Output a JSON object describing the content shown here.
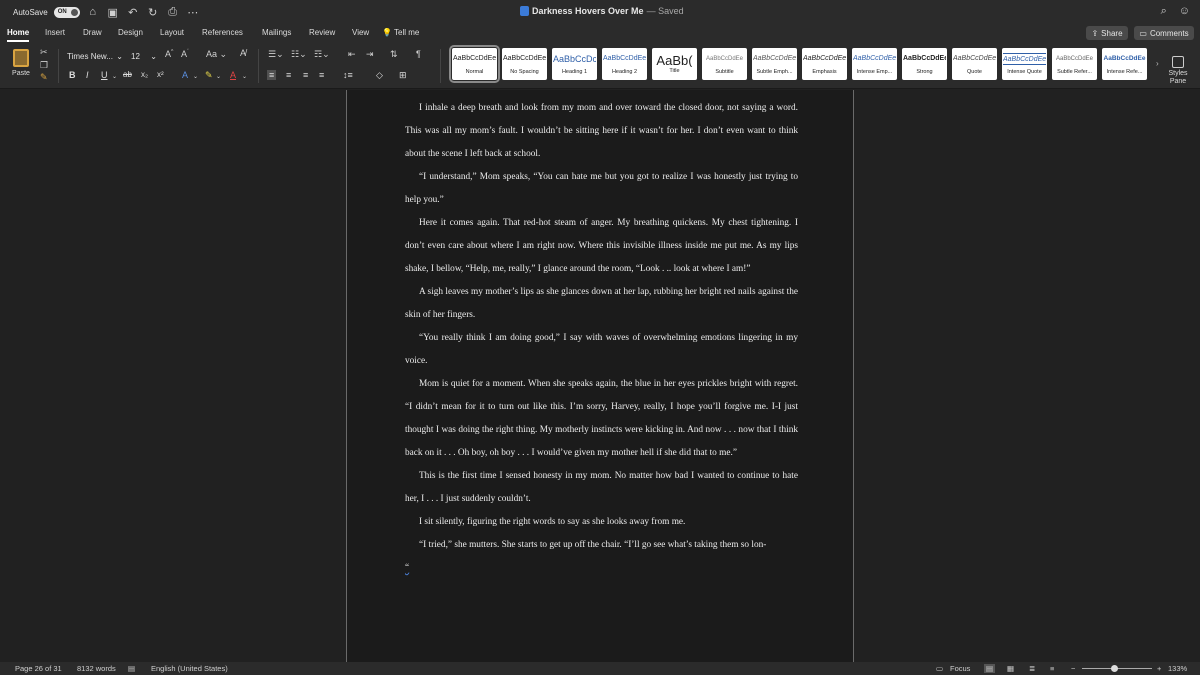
{
  "titlebar": {
    "autosave_label": "AutoSave",
    "autosave_state": "ON",
    "doc_name": "Darkness Hovers Over Me",
    "saved_status": "— Saved"
  },
  "tabs": [
    "Home",
    "Insert",
    "Draw",
    "Design",
    "Layout",
    "References",
    "Mailings",
    "Review",
    "View",
    "Tell me"
  ],
  "share_label": "Share",
  "comments_label": "Comments",
  "ribbon": {
    "paste_label": "Paste",
    "font_name": "Times New...",
    "font_size": "12",
    "styles": [
      {
        "sample": "AaBbCcDdEe",
        "name": "Normal"
      },
      {
        "sample": "AaBbCcDdEe",
        "name": "No Spacing"
      },
      {
        "sample": "AaBbCcDc",
        "name": "Heading 1"
      },
      {
        "sample": "AaBbCcDdEe",
        "name": "Heading 2"
      },
      {
        "sample": "AaBb(",
        "name": "Title"
      },
      {
        "sample": "AaBbCcDdEe",
        "name": "Subtitle"
      },
      {
        "sample": "AaBbCcDdEe",
        "name": "Subtle Emph..."
      },
      {
        "sample": "AaBbCcDdEe",
        "name": "Emphasis"
      },
      {
        "sample": "AaBbCcDdEe",
        "name": "Intense Emp..."
      },
      {
        "sample": "AaBbCcDdEe",
        "name": "Strong"
      },
      {
        "sample": "AaBbCcDdEe",
        "name": "Quote"
      },
      {
        "sample": "AaBbCcDdEe",
        "name": "Intense Quote"
      },
      {
        "sample": "AaBbCcDdEe",
        "name": "Subtle Refer..."
      },
      {
        "sample": "AaBbCcDdEe",
        "name": "Intense Refe..."
      }
    ],
    "styles_pane_label_1": "Styles",
    "styles_pane_label_2": "Pane"
  },
  "document": {
    "paragraphs": [
      "I inhale a deep breath and look from my mom and over toward the closed door, not saying a word. This was all my mom’s fault. I wouldn’t be sitting here if it wasn’t for her. I don’t even want to think about the scene I left back at school.",
      "“I understand,” Mom speaks, “You can hate me but you got to realize I was honestly just trying to help you.”",
      "Here it comes again. That red-hot steam of anger. My breathing quickens. My chest tightening. I don’t even care about where I am right now. Where this invisible illness inside me put me. As my lips shake, I bellow, “Help, me, really,” I glance around the room, “Look . .. look at where I am!”",
      "A sigh leaves my mother’s lips as she glances down at her lap, rubbing her bright red nails against the skin of her fingers.",
      "“You really think I am doing good,” I say with waves of overwhelming emotions lingering in my voice.",
      "Mom is quiet for a moment. When she speaks again, the blue in her eyes prickles bright with regret. “I didn’t mean for it to turn out like this. I’m sorry, Harvey, really, I hope you’ll forgive me. I-I just thought I was doing the right thing. My motherly instincts were kicking in. And now . . . now that I think back on it . . . Oh boy, oh boy . . . I would’ve given my mother hell if she did that to me.”",
      "This is the first time I sensed honesty in my mom. No matter how bad I wanted to continue to hate her, I . . . I just suddenly couldn’t.",
      "I sit silently, figuring the right words to say as she looks away from me.",
      "“I tried,” she mutters. She starts to get up off the chair. “I’ll go see what’s taking them so lon-",
      "“"
    ]
  },
  "status": {
    "page": "Page 26 of 31",
    "words": "8132 words",
    "language": "English (United States)",
    "focus": "Focus",
    "zoom": "133%"
  }
}
